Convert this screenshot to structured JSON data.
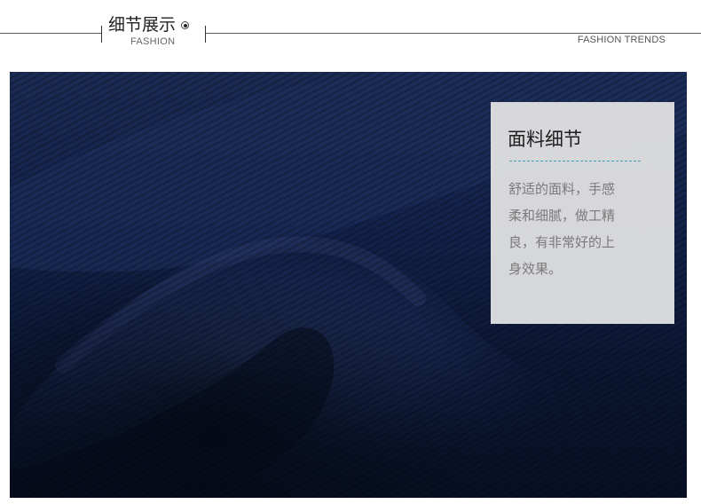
{
  "header": {
    "title_cn": "细节展示",
    "title_en": "FASHION",
    "trends": "FASHION TRENDS"
  },
  "card": {
    "title": "面料细节",
    "lines": [
      "舒适的面料，手感",
      "柔和细腻，做工精",
      "良，有非常好的上",
      "身效果。"
    ]
  },
  "colors": {
    "fabric": "#0d1a36",
    "card_bg": "#e1e1e3",
    "accent_rule": "#3aa6b8",
    "body_text": "#7a7a7a"
  }
}
